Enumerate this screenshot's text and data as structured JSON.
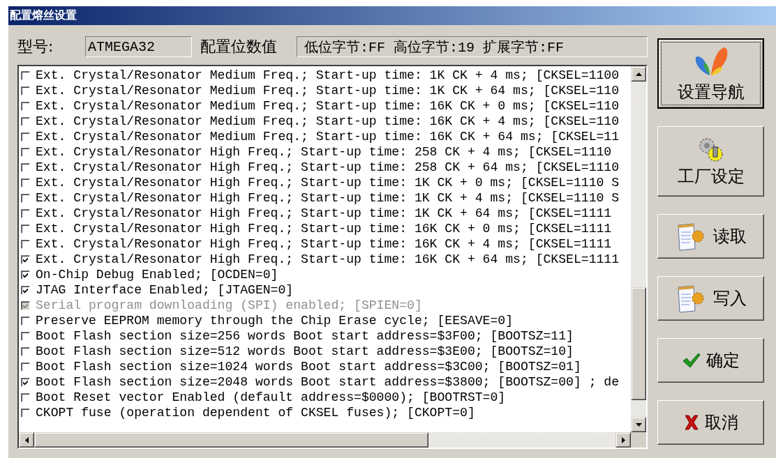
{
  "window": {
    "title": "配置熔丝设置"
  },
  "header": {
    "model_label": "型号:",
    "model_value": "ATMEGA32",
    "fuse_label": "配置位数值",
    "fuse_value": "低位字节:FF 高位字节:19 扩展字节:FF"
  },
  "fuses": [
    {
      "text": "Ext. Crystal/Resonator Medium Freq.; Start-up time: 1K CK + 4 ms; [CKSEL=1100",
      "checked": false,
      "disabled": false
    },
    {
      "text": "Ext. Crystal/Resonator Medium Freq.; Start-up time: 1K CK + 64 ms; [CKSEL=110",
      "checked": false,
      "disabled": false
    },
    {
      "text": "Ext. Crystal/Resonator Medium Freq.; Start-up time: 16K CK + 0 ms; [CKSEL=110",
      "checked": false,
      "disabled": false
    },
    {
      "text": "Ext. Crystal/Resonator Medium Freq.; Start-up time: 16K CK + 4 ms; [CKSEL=110",
      "checked": false,
      "disabled": false
    },
    {
      "text": "Ext. Crystal/Resonator Medium Freq.; Start-up time: 16K CK + 64 ms; [CKSEL=11",
      "checked": false,
      "disabled": false
    },
    {
      "text": "Ext. Crystal/Resonator High Freq.; Start-up time: 258 CK + 4 ms; [CKSEL=1110",
      "checked": false,
      "disabled": false
    },
    {
      "text": "Ext. Crystal/Resonator High Freq.; Start-up time: 258 CK + 64 ms; [CKSEL=1110",
      "checked": false,
      "disabled": false
    },
    {
      "text": "Ext. Crystal/Resonator High Freq.; Start-up time: 1K CK + 0 ms; [CKSEL=1110 S",
      "checked": false,
      "disabled": false
    },
    {
      "text": "Ext. Crystal/Resonator High Freq.; Start-up time: 1K CK + 4 ms; [CKSEL=1110 S",
      "checked": false,
      "disabled": false
    },
    {
      "text": "Ext. Crystal/Resonator High Freq.; Start-up time: 1K CK + 64 ms; [CKSEL=1111",
      "checked": false,
      "disabled": false
    },
    {
      "text": "Ext. Crystal/Resonator High Freq.; Start-up time: 16K CK + 0 ms; [CKSEL=1111",
      "checked": false,
      "disabled": false
    },
    {
      "text": "Ext. Crystal/Resonator High Freq.; Start-up time: 16K CK + 4 ms; [CKSEL=1111",
      "checked": false,
      "disabled": false
    },
    {
      "text": "Ext. Crystal/Resonator High Freq.; Start-up time: 16K CK + 64 ms; [CKSEL=1111",
      "checked": true,
      "disabled": false
    },
    {
      "text": "On-Chip Debug Enabled; [OCDEN=0]",
      "checked": true,
      "disabled": false
    },
    {
      "text": "JTAG Interface Enabled; [JTAGEN=0]",
      "checked": true,
      "disabled": false
    },
    {
      "text": "Serial program downloading (SPI) enabled; [SPIEN=0]",
      "checked": true,
      "disabled": true
    },
    {
      "text": "Preserve EEPROM memory through the Chip Erase cycle; [EESAVE=0]",
      "checked": false,
      "disabled": false
    },
    {
      "text": "Boot Flash section size=256 words Boot start address=$3F00; [BOOTSZ=11]",
      "checked": false,
      "disabled": false
    },
    {
      "text": "Boot Flash section size=512 words Boot start address=$3E00; [BOOTSZ=10]",
      "checked": false,
      "disabled": false
    },
    {
      "text": "Boot Flash section size=1024 words Boot start address=$3C00; [BOOTSZ=01]",
      "checked": false,
      "disabled": false
    },
    {
      "text": "Boot Flash section size=2048 words Boot start address=$3800; [BOOTSZ=00] ; de",
      "checked": true,
      "disabled": false
    },
    {
      "text": "Boot Reset vector Enabled (default address=$0000); [BOOTRST=0]",
      "checked": false,
      "disabled": false
    },
    {
      "text": "CKOPT fuse (operation dependent of CKSEL fuses); [CKOPT=0]",
      "checked": false,
      "disabled": false
    }
  ],
  "buttons": [
    {
      "label": "设置导航",
      "kind": "tall",
      "default": true
    },
    {
      "label": "工厂设定",
      "kind": "tall",
      "default": false
    },
    {
      "label": "读取",
      "kind": "wide",
      "default": false
    },
    {
      "label": "写入",
      "kind": "wide",
      "default": false
    },
    {
      "label": "确定",
      "kind": "wide",
      "default": false
    },
    {
      "label": "取消",
      "kind": "wide",
      "default": false
    }
  ]
}
